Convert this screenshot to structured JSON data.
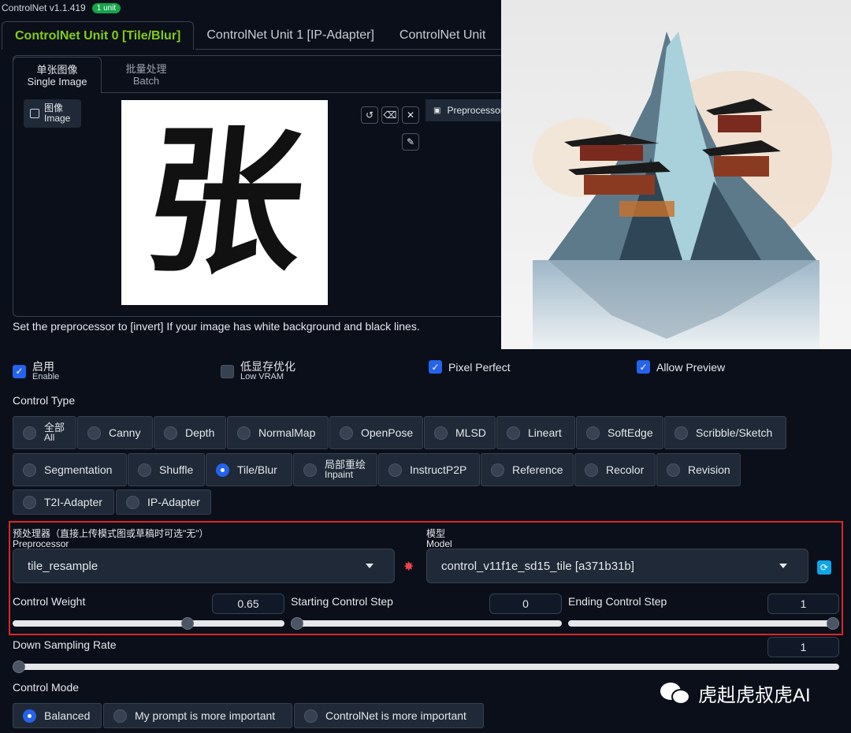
{
  "app": {
    "title": "ControlNet v1.1.419",
    "badge": "1 unit"
  },
  "unit_tabs": [
    "ControlNet Unit 0 [Tile/Blur]",
    "ControlNet Unit 1 [IP-Adapter]",
    "ControlNet Unit"
  ],
  "sub_tabs": [
    {
      "zh": "单张图像",
      "en": "Single Image"
    },
    {
      "zh": "批量处理",
      "en": "Batch"
    }
  ],
  "image_panel": {
    "label_zh": "图像",
    "label_en": "Image",
    "glyph": "张",
    "preprocessor_label": "Preprocessor"
  },
  "hint": "Set the preprocessor to [invert] If your image has white background and black lines.",
  "checkboxes": [
    {
      "zh": "启用",
      "en": "Enable",
      "checked": true
    },
    {
      "zh": "低显存优化",
      "en": "Low VRAM",
      "checked": false
    },
    {
      "label": "Pixel Perfect",
      "checked": true
    },
    {
      "label": "Allow Preview",
      "checked": true
    }
  ],
  "control_type": {
    "title": "Control Type",
    "options": [
      "Canny",
      "Depth",
      "NormalMap",
      "OpenPose",
      "MLSD",
      "Lineart",
      "SoftEdge",
      "Scribble/Sketch",
      "Segmentation",
      "Shuffle",
      "Tile/Blur",
      "InstructP2P",
      "Reference",
      "Recolor",
      "Revision",
      "T2I-Adapter",
      "IP-Adapter"
    ],
    "all_zh": "全部",
    "all_en": "All",
    "inpaint_zh": "局部重绘",
    "inpaint_en": "Inpaint",
    "selected": "Tile/Blur"
  },
  "preprocessor": {
    "title_zh": "预处理器（直接上传模式图或草稿时可选\"无\"）",
    "title_en": "Preprocessor",
    "value": "tile_resample"
  },
  "model": {
    "title_zh": "模型",
    "title_en": "Model",
    "value": "control_v11f1e_sd15_tile [a371b31b]"
  },
  "sliders": {
    "control_weight": {
      "label": "Control Weight",
      "value": "0.65",
      "fraction": 0.65
    },
    "starting_step": {
      "label": "Starting Control Step",
      "value": "0",
      "fraction": 0
    },
    "ending_step": {
      "label": "Ending Control Step",
      "value": "1",
      "fraction": 1
    },
    "down_sampling": {
      "label": "Down Sampling Rate",
      "value": "1",
      "fraction": 0
    }
  },
  "control_mode": {
    "title": "Control Mode",
    "options": [
      "Balanced",
      "My prompt is more important",
      "ControlNet is more important"
    ],
    "selected": "Balanced"
  },
  "watermark": "虎赳虎叔虎AI"
}
